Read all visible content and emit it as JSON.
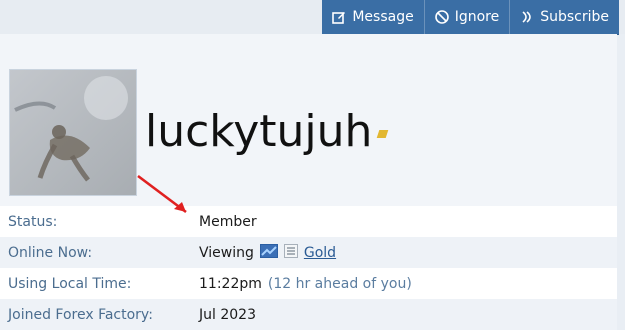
{
  "header": {
    "actions": [
      {
        "label": "Message",
        "icon": "message-edit-icon"
      },
      {
        "label": "Ignore",
        "icon": "ignore-user-icon"
      },
      {
        "label": "Subscribe",
        "icon": "subscribe-icon"
      }
    ]
  },
  "profile": {
    "username": "luckytujuh"
  },
  "info": {
    "rows": [
      {
        "label": "Status:",
        "value": "Member"
      },
      {
        "label": "Online Now:",
        "value_prefix": "Viewing",
        "value_link": "Gold"
      },
      {
        "label": "Using Local Time:",
        "value": "11:22pm",
        "value_note": "(12 hr ahead of you)"
      },
      {
        "label": "Joined Forex Factory:",
        "value": "Jul 2023"
      }
    ]
  },
  "colors": {
    "header_bg": "#3a6ea5",
    "accent_badge": "#e2b731",
    "annotation_arrow": "#e02020"
  }
}
